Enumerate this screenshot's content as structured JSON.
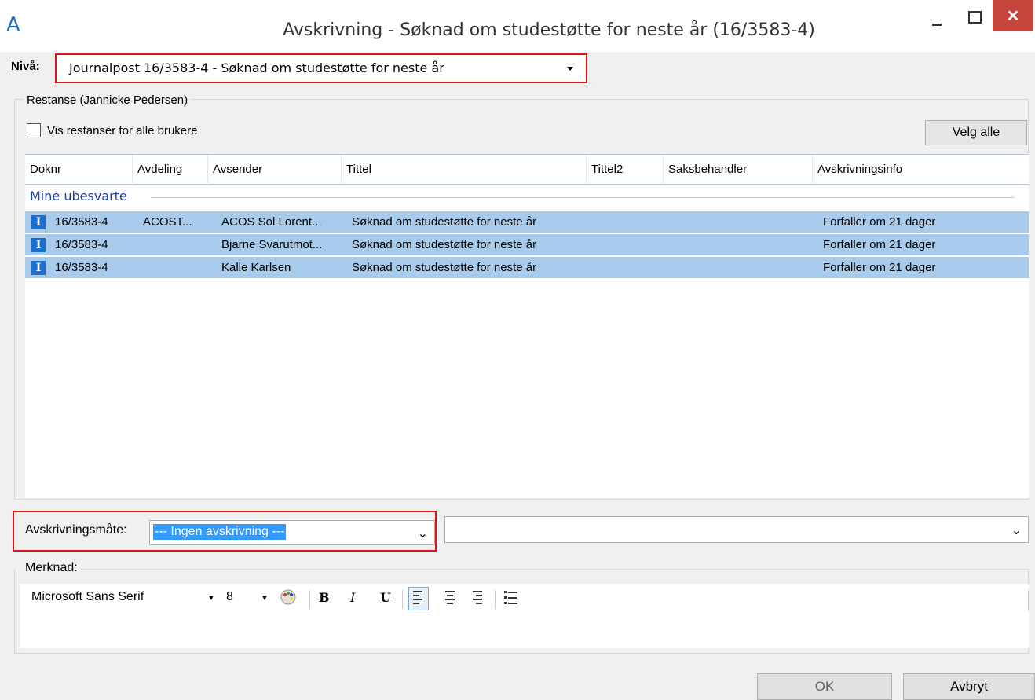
{
  "window": {
    "title": "Avskrivning - Søknad om studestøtte for neste år (16/3583-4)",
    "close_glyph": "✕"
  },
  "niva": {
    "label": "Nivå:",
    "value": "Journalpost 16/3583-4 - Søknad om studestøtte for neste år"
  },
  "restanse": {
    "group_title": "Restanse (Jannicke Pedersen)",
    "show_all_label": "Vis restanser for alle brukere",
    "select_all_label": "Velg alle",
    "columns": [
      "Doknr",
      "Avdeling",
      "Avsender",
      "Tittel",
      "Tittel2",
      "Saksbehandler",
      "Avskrivningsinfo"
    ],
    "group_header": "Mine ubesvarte",
    "rows": [
      {
        "icon": "I",
        "doknr": "16/3583-4",
        "avdeling": "ACOST...",
        "avsender": "ACOS Sol Lorent...",
        "tittel": "Søknad om studestøtte for neste år",
        "tittel2": "",
        "saksbehandler": "",
        "info": "Forfaller om 21 dager"
      },
      {
        "icon": "I",
        "doknr": "16/3583-4",
        "avdeling": "",
        "avsender": "Bjarne Svarutmot...",
        "tittel": "Søknad om studestøtte for neste år",
        "tittel2": "",
        "saksbehandler": "",
        "info": "Forfaller om 21 dager"
      },
      {
        "icon": "I",
        "doknr": "16/3583-4",
        "avdeling": "",
        "avsender": "Kalle Karlsen",
        "tittel": "Søknad om studestøtte for neste år",
        "tittel2": "",
        "saksbehandler": "",
        "info": "Forfaller om 21 dager"
      }
    ]
  },
  "avskrivning": {
    "label": "Avskrivningsmåte:",
    "value": "--- Ingen avskrivning ---",
    "second_value": ""
  },
  "merknad": {
    "label": "Merknad:",
    "font_name": "Microsoft Sans Serif",
    "font_size": "8",
    "bold": "B",
    "italic": "I",
    "underline": "U"
  },
  "buttons": {
    "ok": "OK",
    "cancel": "Avbryt"
  },
  "colors": {
    "selection_row": "#a8cbeb",
    "highlight_border": "#e0121b",
    "close_button": "#c7453a"
  }
}
